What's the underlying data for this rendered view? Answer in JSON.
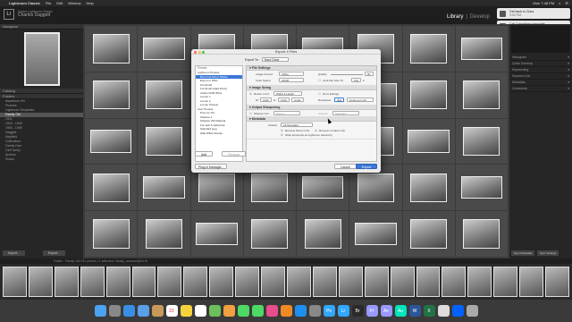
{
  "menubar": {
    "app": "Lightroom Classic",
    "items": [
      "File",
      "Edit",
      "Window",
      "Help"
    ],
    "clock": "Mon 7:48 PM"
  },
  "identity": {
    "logo": "Lr",
    "line1": "Adobe Lightroom Classic",
    "user": "Charles Daggett"
  },
  "modules": {
    "library": "Library",
    "develop": "Develop",
    "sep": "|"
  },
  "notifications": [
    {
      "title": "Get back to Clara",
      "time": "9:00 PM"
    },
    {
      "title": "Call Columbian consulate",
      "time": "10:00 AM"
    }
  ],
  "left_panel": {
    "navigator": "Navigator",
    "catalog": "Catalog",
    "folders": "Folders",
    "folder_items": [
      "Macintosh HD",
      "Pictures",
      "Lightroom Templates",
      "Family Old",
      "1921",
      "1940 - 1949",
      "1950 - 1959",
      "Daggett",
      "Mayfield",
      "Collections",
      "Family Fam",
      "Old Family",
      "Archive",
      "Scans"
    ],
    "import": "Import...",
    "export": "Export..."
  },
  "right_panel": {
    "rows": [
      "Histogram",
      "Quick Develop",
      "Keywording",
      "Keyword List",
      "Metadata",
      "Comments"
    ],
    "sync_metadata": "Sync Metadata",
    "sync_settings": "Sync Settings"
  },
  "filmbar": {
    "text": "Folder : Family Old   241 photos / 1 selected / family_scanned@2x.tif"
  },
  "dialog": {
    "title": "Export 4 Files",
    "export_to_label": "Export To:",
    "export_to_value": "Hard Drive",
    "preset_header": "Preset:",
    "presets": [
      "Lightroom Presets",
      "Burn Full-Sized JPEGs",
      "Export to DNG",
      "For Email",
      "For Email (Hard Drive)",
      "Adobe RGB JPGs",
      "Lumen 1",
      "Lumen 2",
      "Lumen Presets",
      "User Presets",
      "Prep for Vid",
      "Shadow 1",
      "Shadow VID Material",
      "For web & slideshow",
      "Standard jpeg",
      "Wall JPEG Monitor"
    ],
    "selected_preset": "Burn Full-Sized JPEGs",
    "add": "Add",
    "remove": "Remove",
    "sections": {
      "file_settings": "File Settings",
      "image_sizing": "Image Sizing",
      "output_sharpening": "Output Sharpening",
      "metadata": "Metadata"
    },
    "file": {
      "format_label": "Image Format:",
      "format": "JPEG",
      "quality_label": "Quality:",
      "quality": "80",
      "color_label": "Color Space:",
      "color": "sRGB",
      "limit_label": "Limit File Size To:",
      "limit_value": "100",
      "limit_unit": "K"
    },
    "sizing": {
      "resize_label": "Resize to Fit:",
      "resize_mode": "Width & Height",
      "enlarge": "Don't Enlarge",
      "w_label": "W:",
      "w": "1200",
      "h_label": "H:",
      "h": "1200",
      "units": "pixels",
      "res_label": "Resolution:",
      "res": "300",
      "res_units": "pixels per inch"
    },
    "sharpening": {
      "label": "Sharpen For:",
      "value": "Screen",
      "amount_label": "Amount:",
      "amount": "Standard"
    },
    "metadata": {
      "include_label": "Include:",
      "include": "All Metadata",
      "remove_person": "Remove Person Info",
      "remove_location": "Remove Location Info",
      "hierarchy": "Write Keywords as Lightroom Hierarchy"
    },
    "plugin_manager": "Plug-in Manager...",
    "cancel": "Cancel",
    "export": "Export"
  },
  "dock_icons": [
    "finder",
    "launchpad",
    "safari",
    "mail",
    "contacts",
    "calendar",
    "notes",
    "reminders",
    "maps",
    "photos",
    "messages",
    "facetime",
    "itunes",
    "ibooks",
    "appstore",
    "preferences",
    "photoshop",
    "lightroom",
    "bridge",
    "premiere",
    "aftereffects",
    "audition",
    "word",
    "excel",
    "chrome",
    "dropbox",
    "trash"
  ],
  "calendar_day": "22",
  "colors": {
    "accent": "#3b78d8",
    "panel": "#262626",
    "grid": "#3b3b3b"
  }
}
